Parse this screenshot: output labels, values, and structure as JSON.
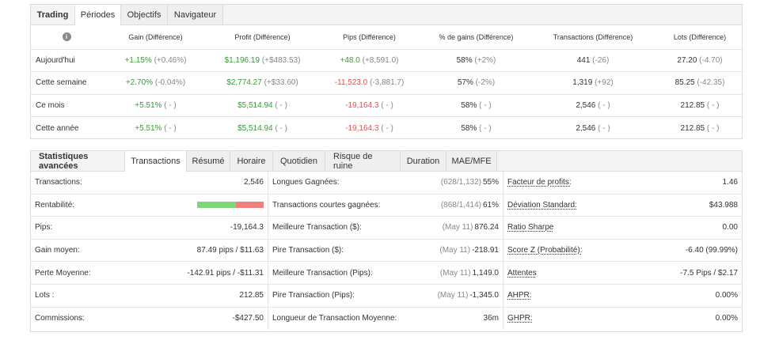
{
  "periods": {
    "tabs": [
      "Trading",
      "Périodes",
      "Objectifs",
      "Navigateur"
    ],
    "info_icon": "i",
    "headers": [
      "Gain (Différence)",
      "Profit (Différence)",
      "Pips (Différence)",
      "% de gains (Différence)",
      "Transactions (Différence)",
      "Lots (Différence)"
    ],
    "rows": [
      {
        "label": "Aujourd'hui",
        "gain": "+1.15%",
        "gain_d": "(+0.46%)",
        "profit": "$1,196.19",
        "profit_d": "(+$483.53)",
        "pips": "+48.0",
        "pips_d": "(+8,591.0)",
        "pct": "58%",
        "pct_d": "(+2%)",
        "trans": "441",
        "trans_d": "(-26)",
        "lots": "27.20",
        "lots_d": "(-4.70)"
      },
      {
        "label": "Cette semaine",
        "gain": "+2.70%",
        "gain_d": "(-0.04%)",
        "profit": "$2,774.27",
        "profit_d": "(+$33.60)",
        "pips": "-11,523.0",
        "pips_d": "(-3,881.7)",
        "pct": "57%",
        "pct_d": "(-2%)",
        "trans": "1,319",
        "trans_d": "(+92)",
        "lots": "85.25",
        "lots_d": "(-42.35)"
      },
      {
        "label": "Ce mois",
        "gain": "+5.51%",
        "gain_d": "( - )",
        "profit": "$5,514.94",
        "profit_d": "( - )",
        "pips": "-19,164.3",
        "pips_d": "( - )",
        "pct": "58%",
        "pct_d": "( - )",
        "trans": "2,546",
        "trans_d": "( - )",
        "lots": "212.85",
        "lots_d": "( - )"
      },
      {
        "label": "Cette année",
        "gain": "+5.51%",
        "gain_d": "( - )",
        "profit": "$5,514.94",
        "profit_d": "( - )",
        "pips": "-19,164.3",
        "pips_d": "( - )",
        "pct": "58%",
        "pct_d": "( - )",
        "trans": "2,546",
        "trans_d": "( - )",
        "lots": "212.85",
        "lots_d": "( - )"
      }
    ]
  },
  "stats": {
    "tabs": [
      "Statistiques avancées",
      "Transactions",
      "Résumé",
      "Horaire",
      "Quotidien",
      "Risque de ruine",
      "Duration",
      "MAE/MFE"
    ],
    "col1": [
      {
        "label": "Transactions:",
        "value": "2,546"
      },
      {
        "label": "Rentabilité:",
        "value": ""
      },
      {
        "label": "Pips:",
        "value": "-19,164.3"
      },
      {
        "label": "Gain moyen:",
        "value": "87.49 pips / $11.63"
      },
      {
        "label": "Perte Moyenne:",
        "value": "-142.91 pips / -$11.31"
      },
      {
        "label": "Lots :",
        "value": "212.85"
      },
      {
        "label": "Commissions:",
        "value": "-$427.50"
      }
    ],
    "profitability": {
      "win_fraction": 0.58,
      "win_color": "#7ed87a",
      "loss_color": "#f08080"
    },
    "col2": [
      {
        "label": "Longues Gagnées:",
        "pre": "(628/1,132)",
        "value": "55%"
      },
      {
        "label": "Transactions courtes gagnées:",
        "pre": "(868/1,414)",
        "value": "61%"
      },
      {
        "label": "Meilleure Transaction ($):",
        "pre": "(May 11)",
        "value": "876.24"
      },
      {
        "label": "Pire Transaction ($):",
        "pre": "(May 11)",
        "value": "-218.91"
      },
      {
        "label": "Meilleure Transaction (Pips):",
        "pre": "(May 11)",
        "value": "1,149.0"
      },
      {
        "label": "Pire Transaction (Pips):",
        "pre": "(May 11)",
        "value": "-1,345.0"
      },
      {
        "label": "Longueur de Transaction Moyenne:",
        "pre": "",
        "value": "36m"
      }
    ],
    "col3": [
      {
        "label": "Facteur de profits:",
        "value": "1.46"
      },
      {
        "label": "Déviation Standard:",
        "value": "$43.988"
      },
      {
        "label": "Ratio Sharpe",
        "value": "0.00"
      },
      {
        "label": "Score Z (Probabilité):",
        "value": "-6.40 (99.99%)"
      },
      {
        "label": "Attentes",
        "value": "-7.5 Pips / $2.17"
      },
      {
        "label": "AHPR:",
        "value": "0.00%"
      },
      {
        "label": "GHPR:",
        "value": "0.00%"
      }
    ]
  }
}
